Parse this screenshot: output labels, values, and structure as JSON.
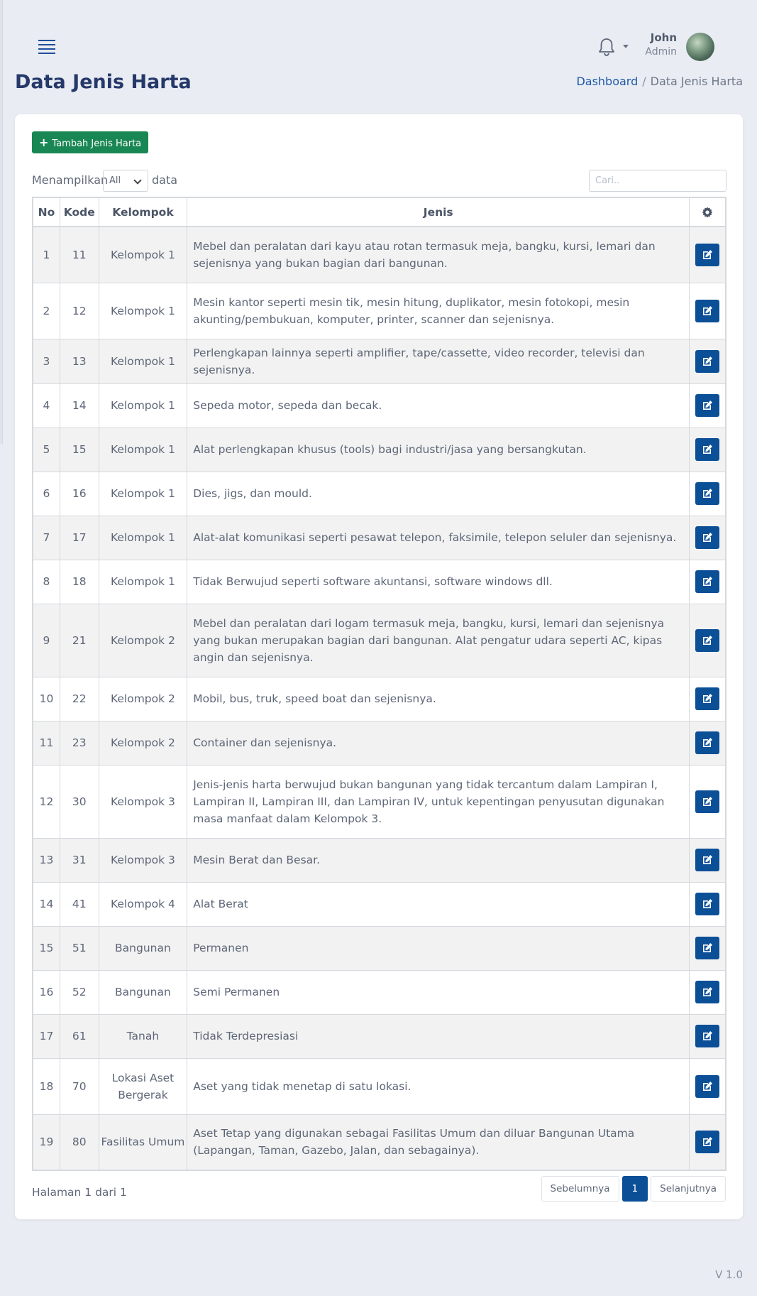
{
  "header": {
    "user_name": "John",
    "user_role": "Admin"
  },
  "page": {
    "title": "Data Jenis Harta",
    "breadcrumb": [
      "Dashboard",
      "/",
      "Data Jenis Harta"
    ]
  },
  "toolbar": {
    "add_label": "Tambah Jenis Harta",
    "show_label": "Menampilkan",
    "show_value": "All",
    "data_label": "data",
    "search_placeholder": "Cari.."
  },
  "table": {
    "headers": [
      "No",
      "Kode",
      "Kelompok",
      "Jenis"
    ],
    "rows": [
      {
        "no": "1",
        "kode": "11",
        "kelompok": "Kelompok 1",
        "jenis": "Mebel dan peralatan dari kayu atau rotan termasuk meja, bangku, kursi, lemari dan sejenisnya yang bukan bagian dari bangunan."
      },
      {
        "no": "2",
        "kode": "12",
        "kelompok": "Kelompok 1",
        "jenis": "Mesin kantor seperti mesin tik, mesin hitung, duplikator, mesin fotokopi, mesin akunting/pembukuan, komputer, printer, scanner dan sejenisnya."
      },
      {
        "no": "3",
        "kode": "13",
        "kelompok": "Kelompok 1",
        "jenis": "Perlengkapan lainnya seperti amplifier, tape/cassette, video recorder, televisi dan sejenisnya."
      },
      {
        "no": "4",
        "kode": "14",
        "kelompok": "Kelompok 1",
        "jenis": "Sepeda motor, sepeda dan becak."
      },
      {
        "no": "5",
        "kode": "15",
        "kelompok": "Kelompok 1",
        "jenis": "Alat perlengkapan khusus (tools) bagi industri/jasa yang bersangkutan."
      },
      {
        "no": "6",
        "kode": "16",
        "kelompok": "Kelompok 1",
        "jenis": "Dies, jigs, dan mould."
      },
      {
        "no": "7",
        "kode": "17",
        "kelompok": "Kelompok 1",
        "jenis": "Alat-alat komunikasi seperti pesawat telepon, faksimile, telepon seluler dan sejenisnya."
      },
      {
        "no": "8",
        "kode": "18",
        "kelompok": "Kelompok 1",
        "jenis": "Tidak Berwujud seperti software akuntansi, software windows dll."
      },
      {
        "no": "9",
        "kode": "21",
        "kelompok": "Kelompok 2",
        "jenis": "Mebel dan peralatan dari logam termasuk meja, bangku, kursi, lemari dan sejenisnya yang bukan merupakan bagian dari bangunan. Alat pengatur udara seperti AC, kipas angin dan sejenisnya."
      },
      {
        "no": "10",
        "kode": "22",
        "kelompok": "Kelompok 2",
        "jenis": "Mobil, bus, truk, speed boat dan sejenisnya."
      },
      {
        "no": "11",
        "kode": "23",
        "kelompok": "Kelompok 2",
        "jenis": "Container dan sejenisnya."
      },
      {
        "no": "12",
        "kode": "30",
        "kelompok": "Kelompok 3",
        "jenis": "Jenis-jenis harta berwujud bukan bangunan yang tidak tercantum dalam Lampiran I, Lampiran II, Lampiran III, dan Lampiran IV, untuk kepentingan penyusutan digunakan masa manfaat dalam Kelompok 3."
      },
      {
        "no": "13",
        "kode": "31",
        "kelompok": "Kelompok 3",
        "jenis": "Mesin Berat dan Besar."
      },
      {
        "no": "14",
        "kode": "41",
        "kelompok": "Kelompok 4",
        "jenis": "Alat Berat"
      },
      {
        "no": "15",
        "kode": "51",
        "kelompok": "Bangunan",
        "jenis": "Permanen"
      },
      {
        "no": "16",
        "kode": "52",
        "kelompok": "Bangunan",
        "jenis": "Semi Permanen"
      },
      {
        "no": "17",
        "kode": "61",
        "kelompok": "Tanah",
        "jenis": "Tidak Terdepresiasi"
      },
      {
        "no": "18",
        "kode": "70",
        "kelompok": "Lokasi Aset Bergerak",
        "jenis": "Aset yang tidak menetap di satu lokasi."
      },
      {
        "no": "19",
        "kode": "80",
        "kelompok": "Fasilitas Umum",
        "jenis": "Aset Tetap yang digunakan sebagai Fasilitas Umum dan diluar Bangunan Utama (Lapangan, Taman, Gazebo, Jalan, dan sebagainya)."
      }
    ]
  },
  "pagination": {
    "info": "Halaman 1 dari 1",
    "prev_label": "Sebelumnya",
    "current_page": "1",
    "next_label": "Selanjutnya"
  },
  "footer": {
    "version": "V 1.0"
  },
  "colors": {
    "primary": "#0b4f97",
    "success": "#198754",
    "title": "#25386a"
  }
}
